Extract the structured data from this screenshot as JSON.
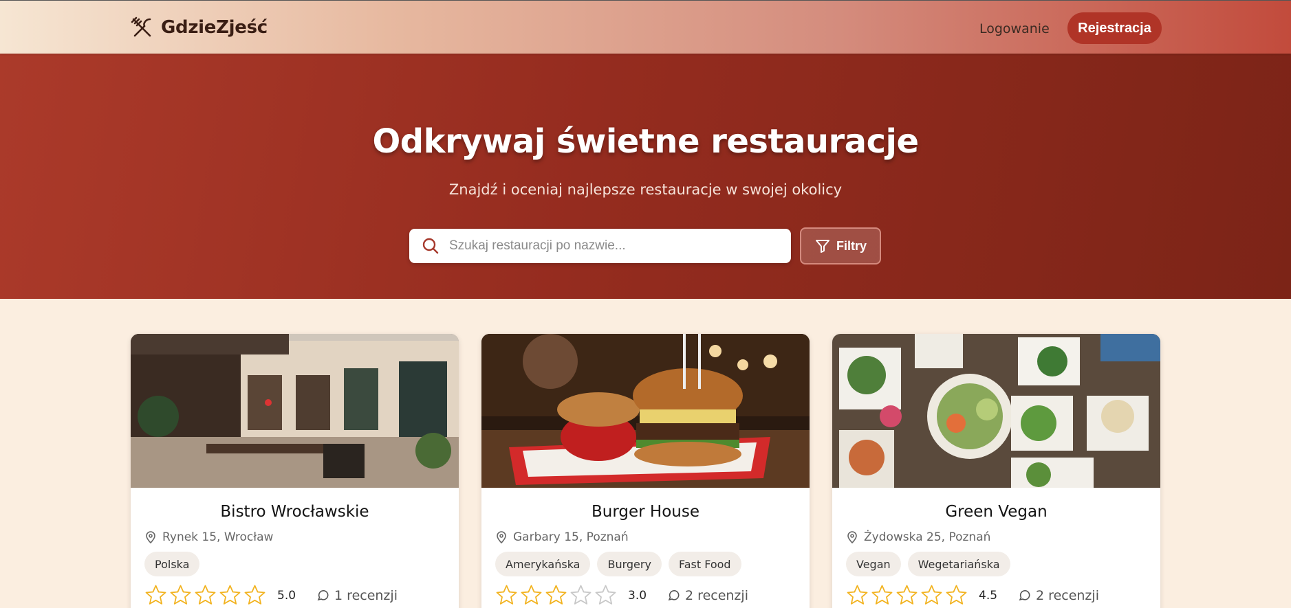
{
  "header": {
    "brand": "GdzieZjeść",
    "login_label": "Logowanie",
    "register_label": "Rejestracja"
  },
  "hero": {
    "title": "Odkrywaj świetne restauracje",
    "subtitle": "Znajdź i oceniaj najlepsze restauracje w swojej okolicy",
    "search_placeholder": "Szukaj restauracji po nazwie...",
    "filters_label": "Filtry"
  },
  "colors": {
    "accent": "#b03427",
    "hero_bg": "#952c1f",
    "star": "#f2b320",
    "star_empty": "#c8c8c8"
  },
  "icons": {
    "brand": "utensils-crossed-icon",
    "search": "search-icon",
    "filter": "filter-funnel-icon",
    "address": "map-pin-icon",
    "reviews": "chat-bubble-icon",
    "rating": "star-icon"
  },
  "restaurants": [
    {
      "name": "Bistro Wrocławskie",
      "address": "Rynek 15, Wrocław",
      "tags": [
        "Polska"
      ],
      "rating": 5.0,
      "rating_label": "5.0",
      "reviews_label": "1 recenzji",
      "image": "outdoor-cafe-street-photo"
    },
    {
      "name": "Burger House",
      "address": "Garbary 15, Poznań",
      "tags": [
        "Amerykańska",
        "Burgery",
        "Fast Food"
      ],
      "rating": 3.0,
      "rating_label": "3.0",
      "reviews_label": "2 recenzji",
      "image": "burger-and-fries-photo"
    },
    {
      "name": "Green Vegan",
      "address": "Żydowska 25, Poznań",
      "tags": [
        "Vegan",
        "Wegetariańska"
      ],
      "rating": 4.5,
      "rating_label": "4.5",
      "reviews_label": "2 recenzji",
      "image": "vegan-dishes-table-photo"
    }
  ]
}
